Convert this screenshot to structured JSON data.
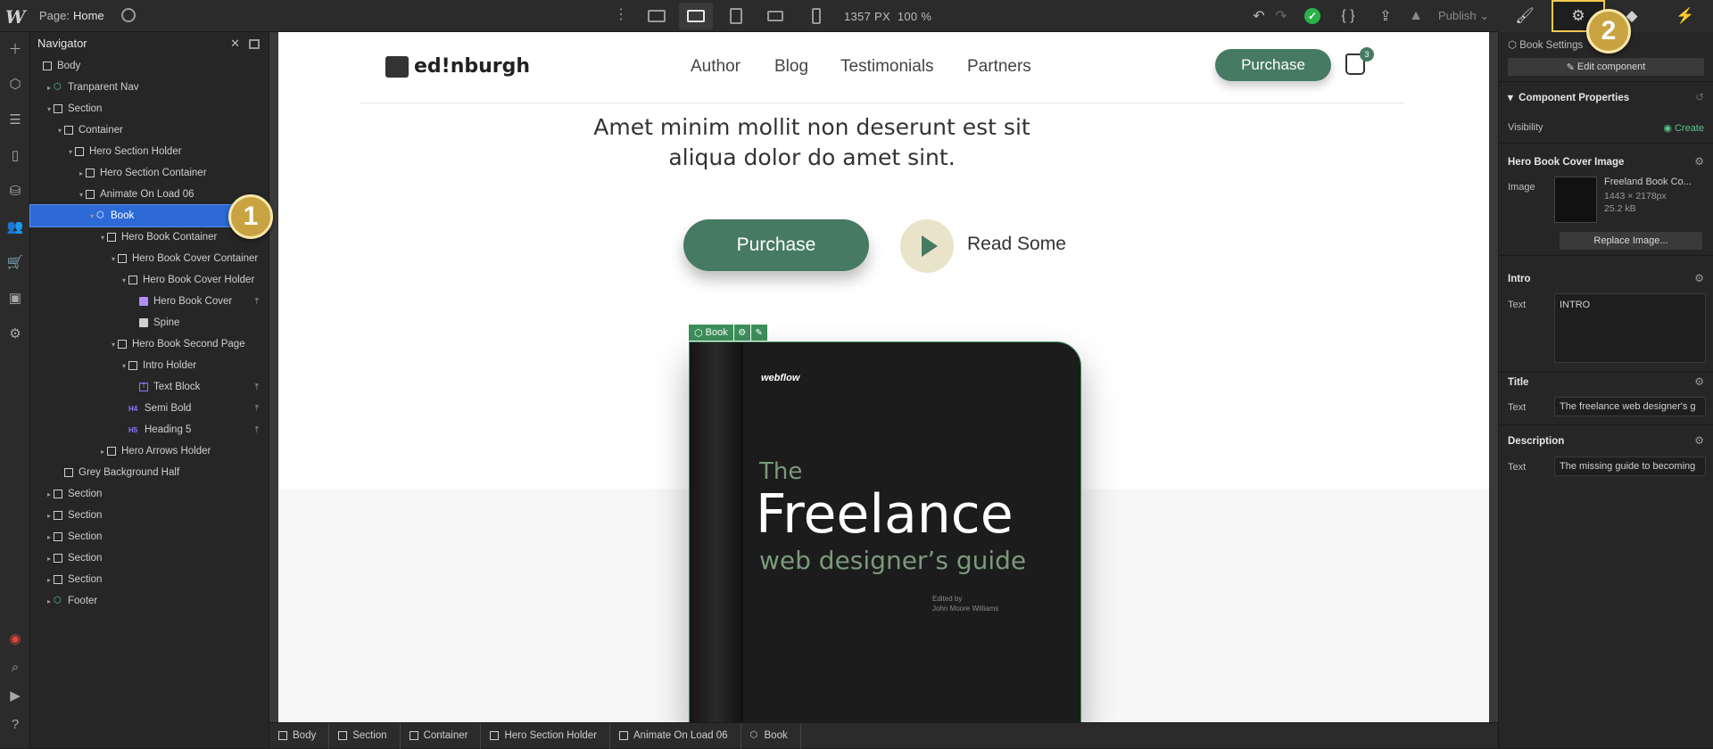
{
  "topbar": {
    "logo": "W",
    "page_label": "Page:",
    "page_name": "Home",
    "canvas_size": "1357 PX",
    "zoom": "100 %",
    "publish_label": "Publish",
    "undo_icon": "undo-icon",
    "redo_icon": "redo-icon",
    "code_icon": "code-icon",
    "export_icon": "export-icon"
  },
  "right_tabs": [
    "style-brush-icon",
    "settings-gear-icon",
    "interactions-drop-icon",
    "lightning-icon"
  ],
  "navigator": {
    "title": "Navigator",
    "items": [
      {
        "label": "Body",
        "depth": 0,
        "icon": "box",
        "caret": ""
      },
      {
        "label": "Tranparent Nav",
        "depth": 1,
        "icon": "component",
        "caret": "▸"
      },
      {
        "label": "Section",
        "depth": 1,
        "icon": "box",
        "caret": "▾"
      },
      {
        "label": "Container",
        "depth": 2,
        "icon": "box",
        "caret": "▾"
      },
      {
        "label": "Hero Section Holder",
        "depth": 3,
        "icon": "box",
        "caret": "▾"
      },
      {
        "label": "Hero Section Container",
        "depth": 4,
        "icon": "box",
        "caret": "▸"
      },
      {
        "label": "Animate On Load 06",
        "depth": 4,
        "icon": "box",
        "caret": "▾"
      },
      {
        "label": "Book",
        "depth": 5,
        "icon": "component",
        "caret": "▾",
        "selected": true
      },
      {
        "label": "Hero Book Container",
        "depth": 6,
        "icon": "box",
        "caret": "▾"
      },
      {
        "label": "Hero Book Cover Container",
        "depth": 7,
        "icon": "box",
        "caret": "▾"
      },
      {
        "label": "Hero Book Cover Holder",
        "depth": 8,
        "icon": "box",
        "caret": "▾"
      },
      {
        "label": "Hero Book Cover",
        "depth": 9,
        "icon": "image",
        "caret": "",
        "pin": true
      },
      {
        "label": "Spine",
        "depth": 9,
        "icon": "image2",
        "caret": ""
      },
      {
        "label": "Hero Book Second Page",
        "depth": 7,
        "icon": "box",
        "caret": "▾"
      },
      {
        "label": "Intro Holder",
        "depth": 8,
        "icon": "box",
        "caret": "▾"
      },
      {
        "label": "Text Block",
        "depth": 9,
        "icon": "text",
        "caret": "",
        "pin": true
      },
      {
        "label": "Semi Bold",
        "depth": 8,
        "icon": "h4",
        "caret": "",
        "pin": true
      },
      {
        "label": "Heading 5",
        "depth": 8,
        "icon": "h5",
        "caret": "",
        "pin": true
      },
      {
        "label": "Hero Arrows Holder",
        "depth": 6,
        "icon": "box",
        "caret": "▸"
      },
      {
        "label": "Grey Background Half",
        "depth": 2,
        "icon": "box",
        "caret": ""
      },
      {
        "label": "Section",
        "depth": 1,
        "icon": "box",
        "caret": "▸"
      },
      {
        "label": "Section",
        "depth": 1,
        "icon": "box",
        "caret": "▸"
      },
      {
        "label": "Section",
        "depth": 1,
        "icon": "box",
        "caret": "▸"
      },
      {
        "label": "Section",
        "depth": 1,
        "icon": "box",
        "caret": "▸"
      },
      {
        "label": "Section",
        "depth": 1,
        "icon": "box",
        "caret": "▸"
      },
      {
        "label": "Footer",
        "depth": 1,
        "icon": "component",
        "caret": "▸"
      }
    ]
  },
  "callouts": {
    "one": "1",
    "two": "2"
  },
  "canvas": {
    "logo": "ed!nburgh",
    "nav": [
      "Author",
      "Blog",
      "Testimonials",
      "Partners"
    ],
    "header_purchase": "Purchase",
    "cart_count": "3",
    "hero_text": "Amet minim mollit non deserunt est sit aliqua dolor do amet sint.",
    "purchase_button": "Purchase",
    "read_some": "Read Some",
    "book_label": "Book",
    "book": {
      "brand": "webflow",
      "the": "The",
      "title": "Freelance",
      "subtitle": "web designer’s guide",
      "edited_by": "Edited by",
      "editor": "John Moore Williams"
    }
  },
  "breadcrumbs": [
    "Body",
    "Section",
    "Container",
    "Hero Section Holder",
    "Animate On Load 06",
    "Book"
  ],
  "right_panel": {
    "header": "Book Settings",
    "edit_component": "Edit component",
    "component_properties": "Component Properties",
    "visibility_label": "Visibility",
    "visibility_value": "Create",
    "cover_section": "Hero Book Cover Image",
    "image_label": "Image",
    "image_name": "Freeland Book Co...",
    "image_dims": "1443 × 2178px",
    "image_size": "25.2 kB",
    "replace_image": "Replace Image...",
    "intro_section": "Intro",
    "intro_text_label": "Text",
    "intro_text": "INTRO",
    "title_section": "Title",
    "title_text_label": "Text",
    "title_text": "The freelance web designer's g",
    "desc_section": "Description",
    "desc_text_label": "Text",
    "desc_text": "The missing guide to becoming"
  }
}
